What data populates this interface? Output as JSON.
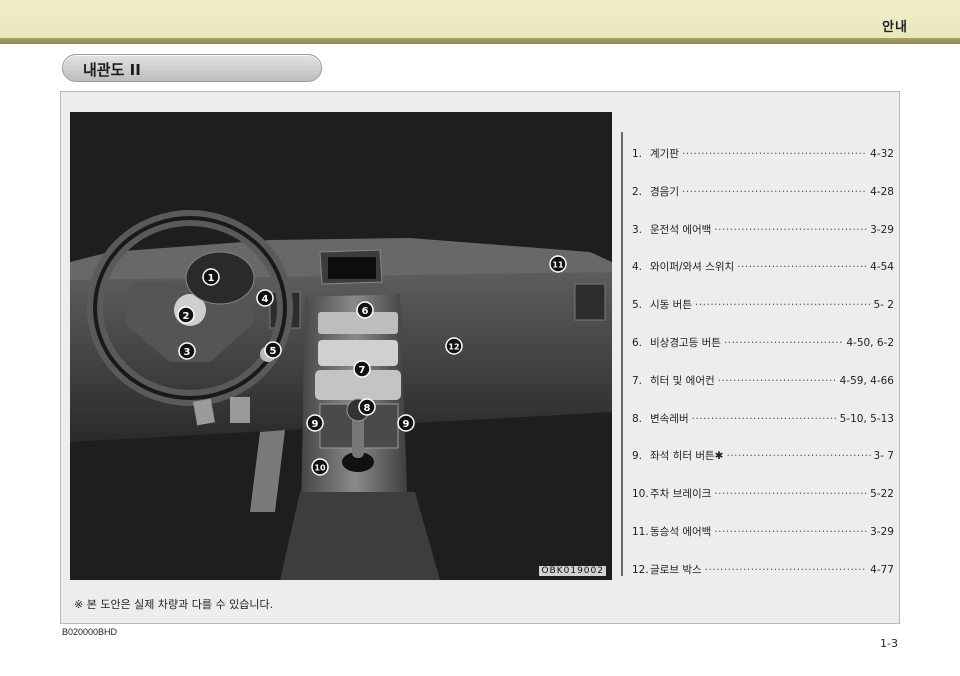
{
  "header": {
    "title": "안내"
  },
  "section": {
    "title": "내관도 II"
  },
  "photo": {
    "code": "OBK019002"
  },
  "callouts": [
    "1",
    "2",
    "3",
    "4",
    "5",
    "6",
    "7",
    "8",
    "9",
    "9",
    "10",
    "11",
    "12"
  ],
  "legend": [
    {
      "num": "1.",
      "label": "계기판",
      "page": "4-32"
    },
    {
      "num": "2.",
      "label": "경음기",
      "page": "4-28"
    },
    {
      "num": "3.",
      "label": "운전석 에어백",
      "page": "3-29"
    },
    {
      "num": "4.",
      "label": "와이퍼/와셔 스위치",
      "page": "4-54"
    },
    {
      "num": "5.",
      "label": "시동 버튼",
      "page": "5- 2"
    },
    {
      "num": "6.",
      "label": "비상경고등 버튼",
      "page": "4-50, 6-2"
    },
    {
      "num": "7.",
      "label": "히터 및 에어컨",
      "page": "4-59, 4-66"
    },
    {
      "num": "8.",
      "label": "변속레버",
      "page": "5-10, 5-13"
    },
    {
      "num": "9.",
      "label": "좌석 히터 버튼✱",
      "page": "3- 7"
    },
    {
      "num": "10.",
      "label": "주차 브레이크",
      "page": "5-22"
    },
    {
      "num": "11.",
      "label": "동승석 에어백",
      "page": "3-29"
    },
    {
      "num": "12.",
      "label": "글로브 박스",
      "page": "4-77"
    }
  ],
  "note": "※ 본 도안은 실제 차량과 다를 수 있습니다.",
  "doc_code": "B020000BHD",
  "page_number": "1-3"
}
